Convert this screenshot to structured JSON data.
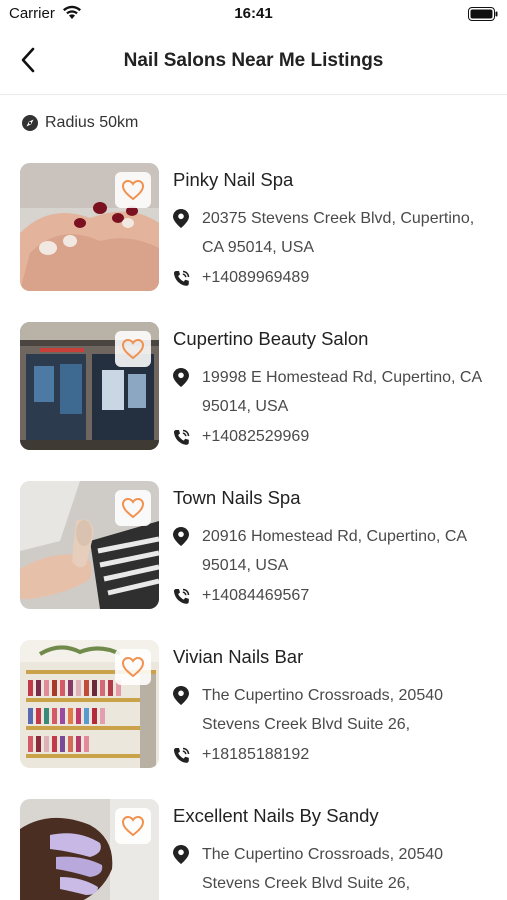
{
  "status_bar": {
    "carrier": "Carrier",
    "time": "16:41"
  },
  "header": {
    "title": "Nail Salons Near Me Listings"
  },
  "filter": {
    "radius_label": "Radius 50km"
  },
  "colors": {
    "accent": "#f0914f",
    "text": "#222222",
    "secondary_text": "#4a4a4a"
  },
  "listings": [
    {
      "name": "Pinky Nail Spa",
      "address": "20375 Stevens Creek Blvd, Cupertino, CA 95014, USA",
      "phone": "+14089969489"
    },
    {
      "name": "Cupertino Beauty Salon",
      "address": "19998 E Homestead Rd, Cupertino, CA 95014, USA",
      "phone": "+14082529969"
    },
    {
      "name": "Town Nails Spa",
      "address": "20916 Homestead Rd, Cupertino, CA 95014, USA",
      "phone": "+14084469567"
    },
    {
      "name": "Vivian Nails Bar",
      "address": "The Cupertino Crossroads, 20540 Stevens Creek Blvd Suite 26,",
      "phone": "+18185188192"
    },
    {
      "name": "Excellent Nails By Sandy",
      "address": "The Cupertino Crossroads, 20540 Stevens Creek Blvd Suite 26,",
      "phone": ""
    }
  ]
}
